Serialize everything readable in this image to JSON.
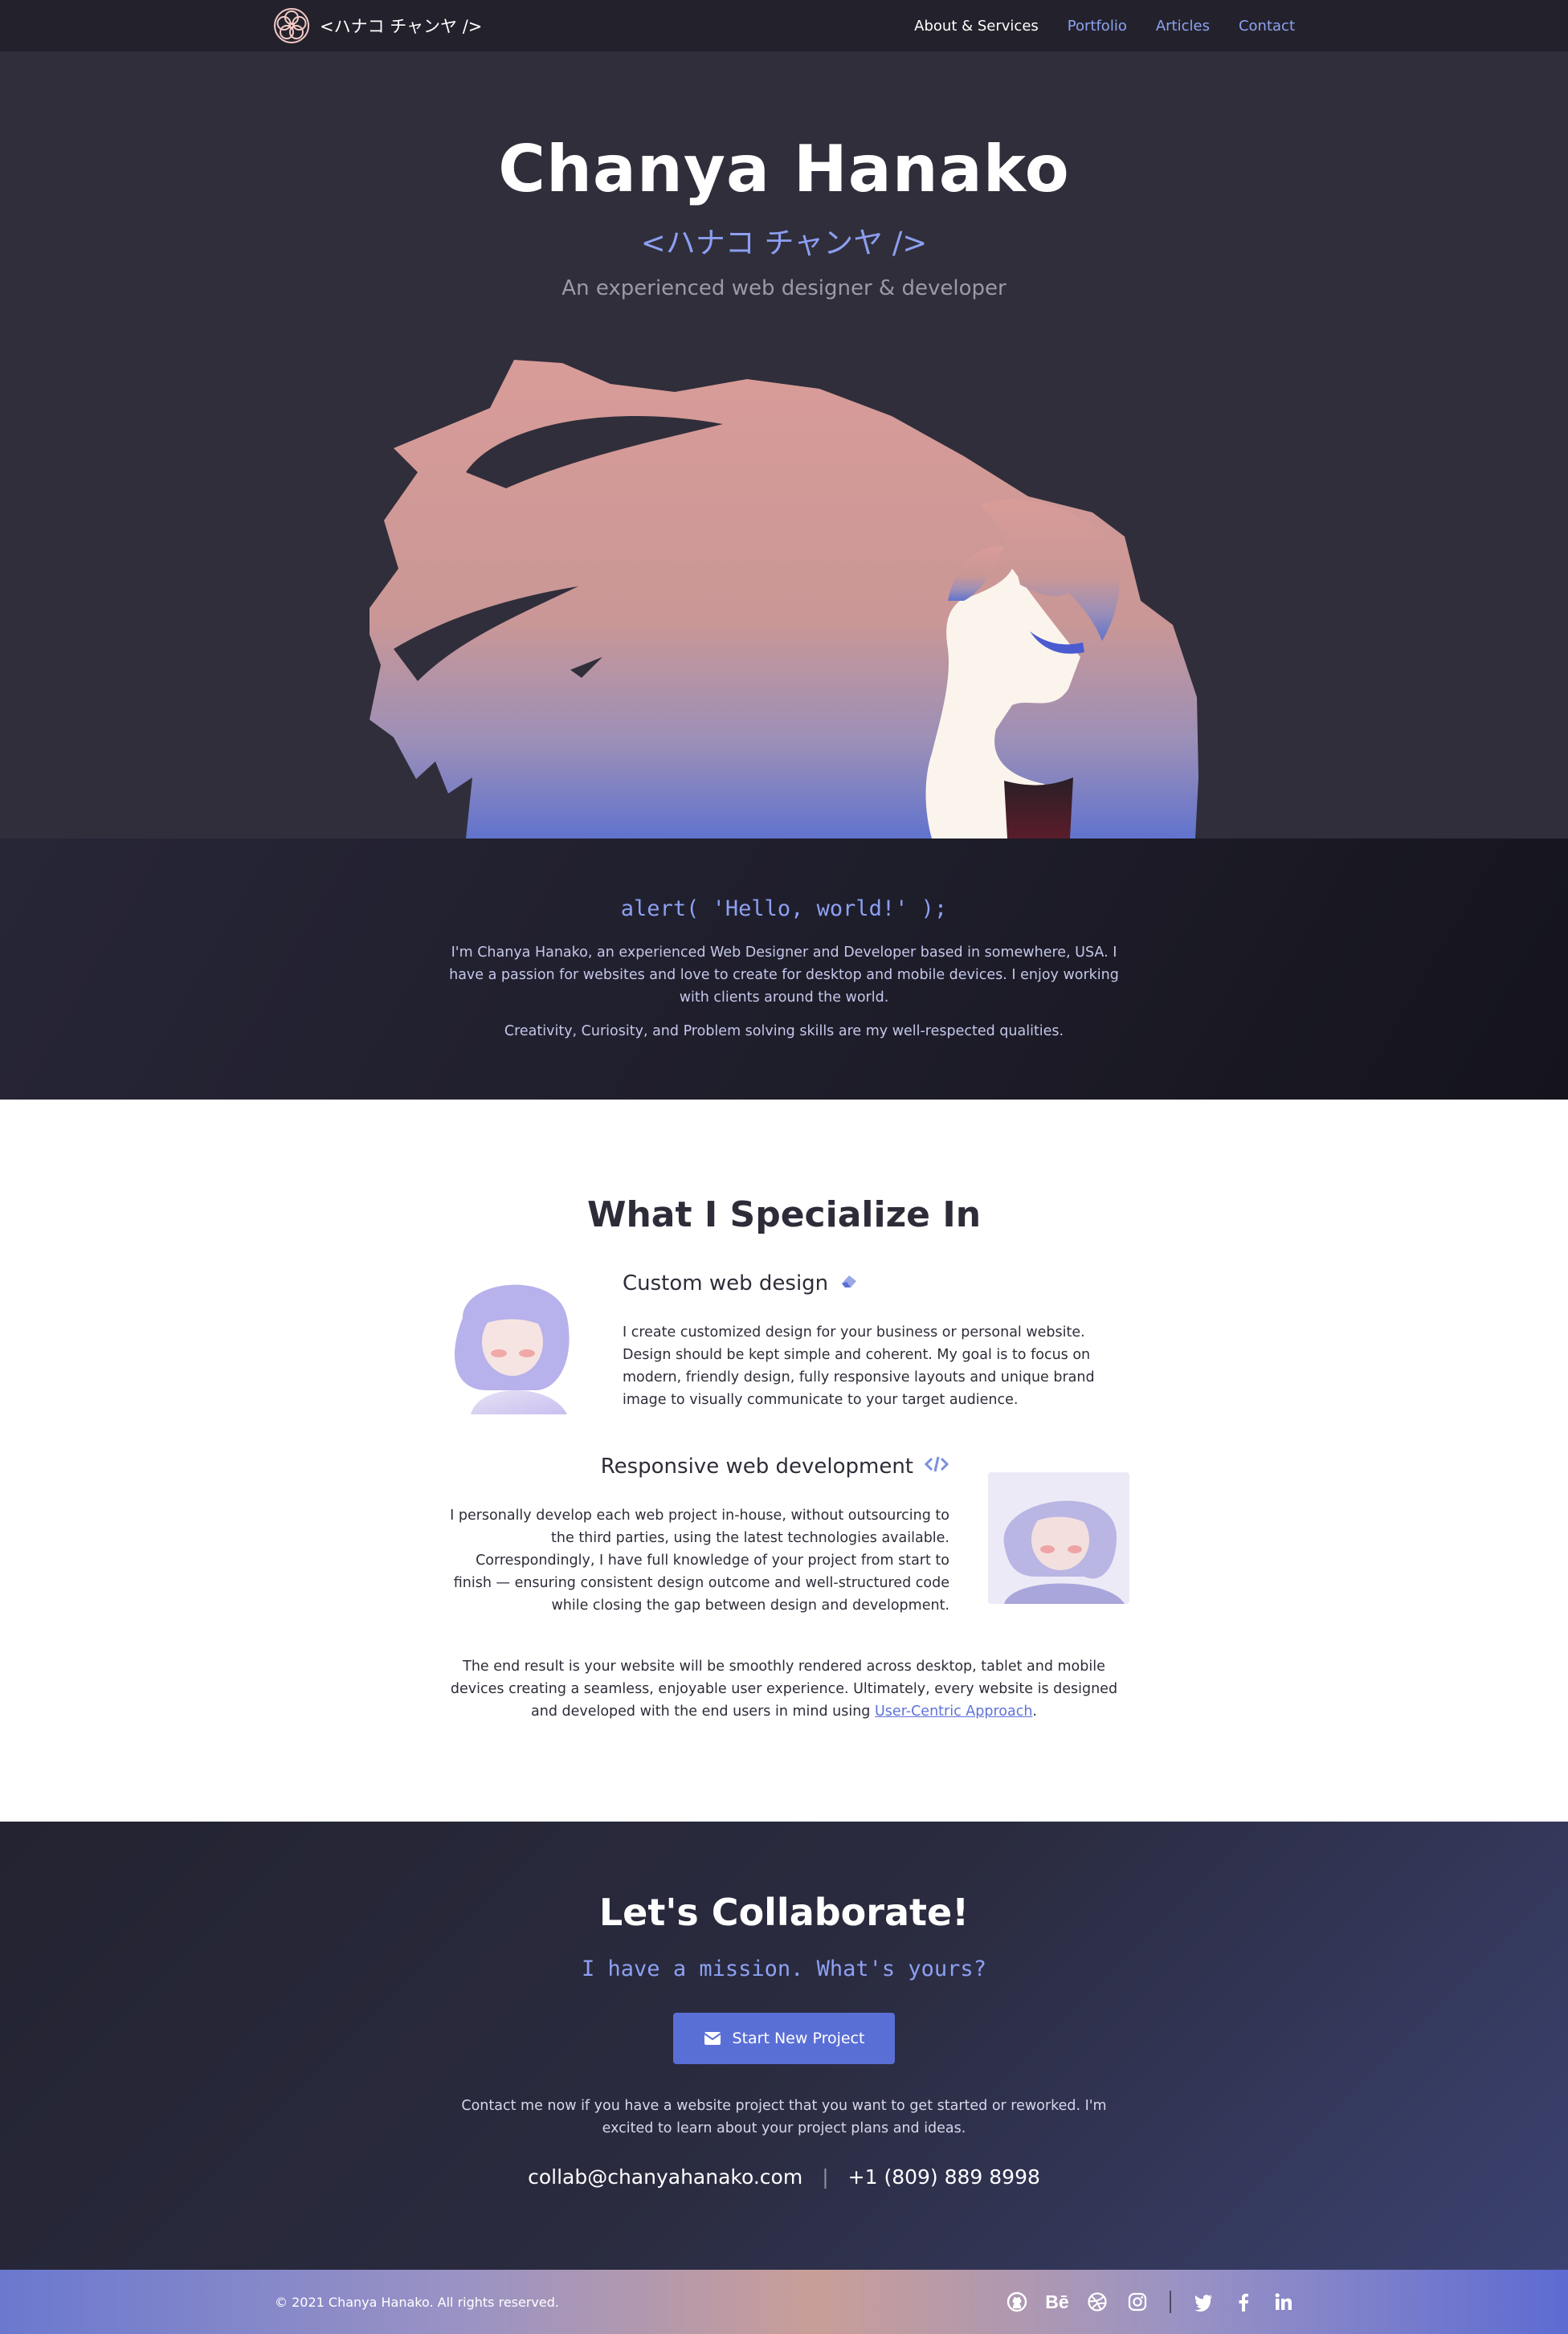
{
  "nav": {
    "brand": "<ハナコ チャンヤ />",
    "links": [
      {
        "label": "About & Services"
      },
      {
        "label": "Portfolio"
      },
      {
        "label": "Articles"
      },
      {
        "label": "Contact"
      }
    ]
  },
  "hero": {
    "title": "Chanya Hanako",
    "subtitle": "<ハナコ チャンヤ />",
    "description": "An experienced web designer & developer"
  },
  "about": {
    "code": "alert( 'Hello, world!' );",
    "paragraph1": "I'm Chanya Hanako, an experienced Web Designer and Developer based in somewhere, USA. I have a passion for websites and love to create for desktop and mobile devices. I enjoy working with clients around the world.",
    "paragraph2": "Creativity, Curiosity, and Problem solving skills are my well-respected qualities."
  },
  "specialize": {
    "title": "What I Specialize In",
    "services": [
      {
        "title": "Custom web design",
        "icon": "eraser-icon",
        "body": "I create customized design for your business or personal website. Design should be kept simple and coherent. My goal is to focus on modern, friendly design, fully responsive layouts and unique brand image to visually communicate to your target audience."
      },
      {
        "title": "Responsive web development",
        "icon": "code-icon",
        "body": "I personally develop each web project in-house, without outsourcing to the third parties, using the latest technologies available. Correspondingly, I have full knowledge of your project from start to finish — ensuring consistent design outcome and well-structured code while closing the gap between design and development."
      }
    ],
    "end_text": "The end result is your website will be smoothly rendered across desktop, tablet and mobile devices creating a seamless, enjoyable user experience. Ultimately, every website is designed and developed with the end users in mind using",
    "end_link": "User-Centric Approach",
    "end_period": "."
  },
  "collab": {
    "title": "Let's Collaborate!",
    "subtitle": "I have a mission. What's yours?",
    "button": "Start New Project",
    "paragraph": "Contact me now if you have a website project that you want to get started or reworked. I'm excited to learn about your project plans and ideas.",
    "email": "collab@chanyahanako.com",
    "separator": "|",
    "phone": "+1 (809) 889 8998"
  },
  "footer": {
    "copyright": "© 2021 Chanya Hanako. All rights reserved.",
    "socials": [
      "github-icon",
      "behance-icon",
      "dribbble-icon",
      "instagram-icon",
      "twitter-icon",
      "facebook-icon",
      "linkedin-icon"
    ],
    "behance_text": "Bē"
  },
  "colors": {
    "accent": "#8da0f2",
    "button": "#5a6fd6",
    "dark": "#302e3b",
    "hair": "#d49f9b"
  }
}
